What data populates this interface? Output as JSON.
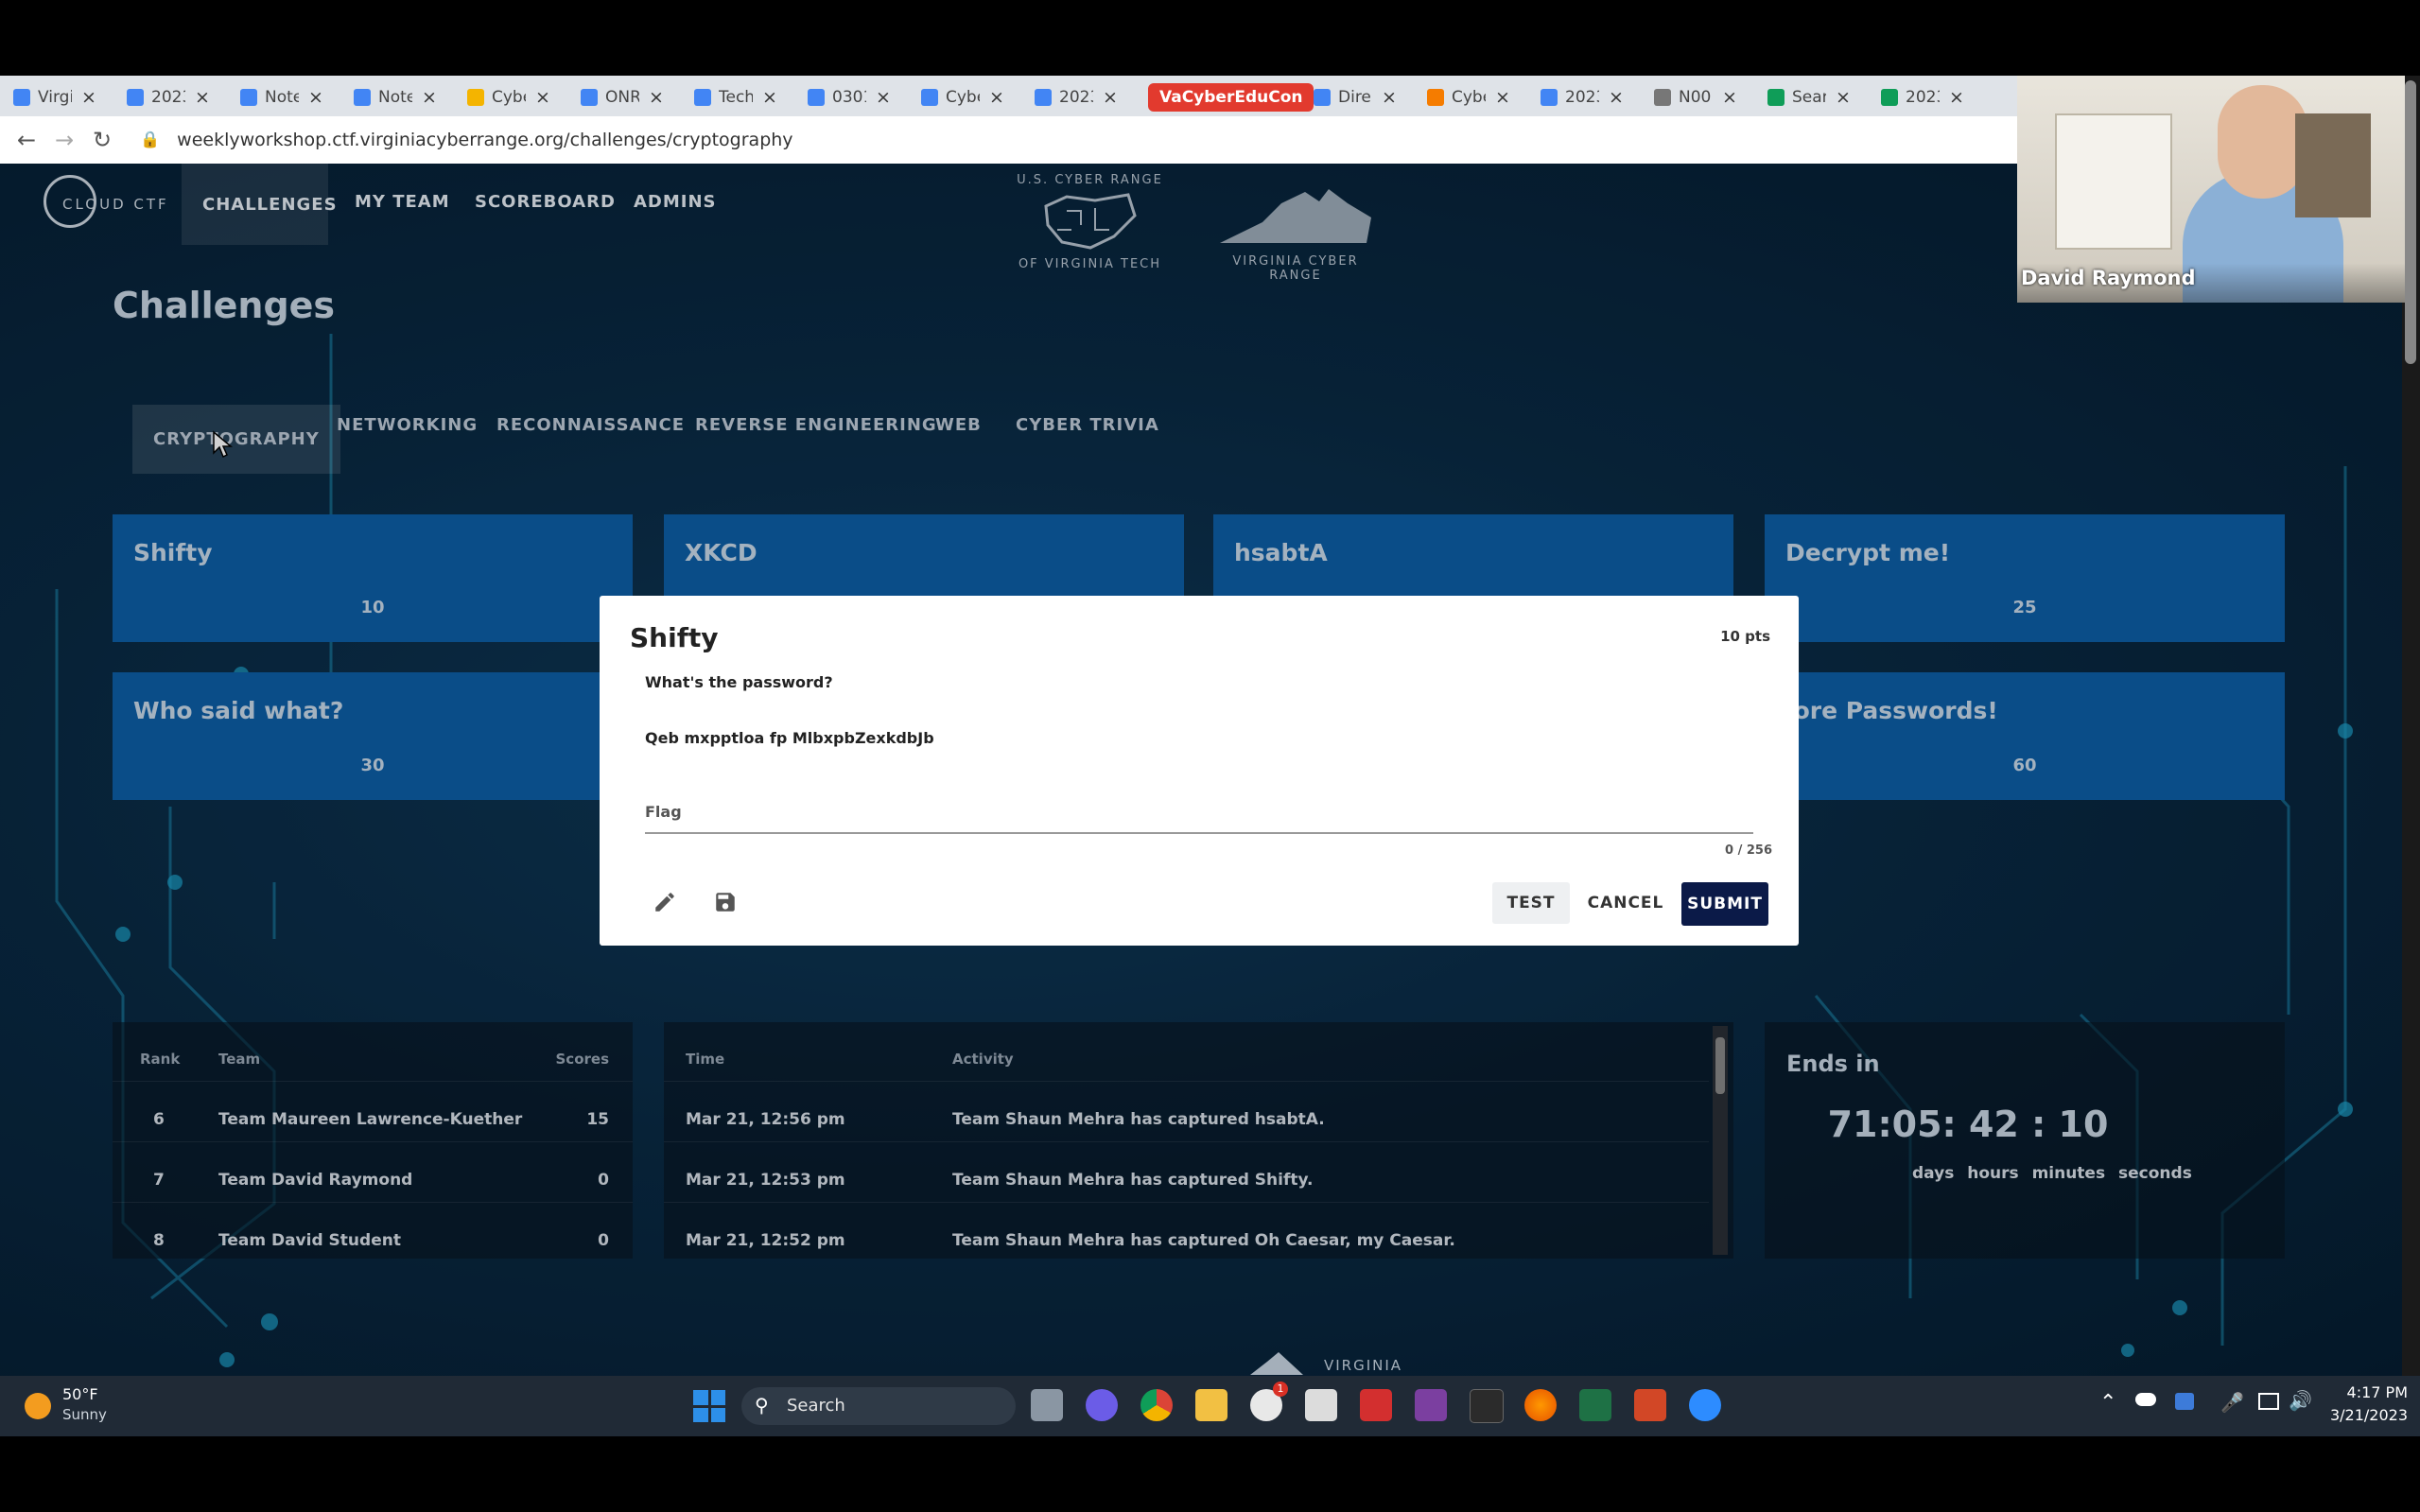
{
  "browser": {
    "tabs": [
      {
        "title": "Virgi",
        "color": "#4285f4"
      },
      {
        "title": "2023",
        "color": "#4285f4"
      },
      {
        "title": "Note",
        "color": "#4285f4"
      },
      {
        "title": "Note",
        "color": "#4285f4"
      },
      {
        "title": "Cybe",
        "color": "#f4b400"
      },
      {
        "title": "ONR",
        "color": "#4285f4"
      },
      {
        "title": "Tech",
        "color": "#4285f4"
      },
      {
        "title": "0301",
        "color": "#4285f4"
      },
      {
        "title": "Cybe",
        "color": "#4285f4"
      },
      {
        "title": "2023",
        "color": "#4285f4"
      },
      {
        "title": "VaCyberEduCon",
        "color": "#e23a2e"
      },
      {
        "title": "Dire",
        "color": "#4285f4"
      },
      {
        "title": "Cybe",
        "color": "#f57c00"
      },
      {
        "title": "2023",
        "color": "#4285f4"
      },
      {
        "title": "N00",
        "color": "#777777"
      },
      {
        "title": "Sear",
        "color": "#0f9d58"
      },
      {
        "title": "2023",
        "color": "#0f9d58"
      }
    ],
    "url": "weeklyworkshop.ctf.virginiacyberrange.org/challenges/cryptography"
  },
  "site": {
    "logo_text": "CLOUD CTF",
    "nav": [
      "CHALLENGES",
      "MY TEAM",
      "SCOREBOARD",
      "ADMINS"
    ],
    "partner1_top": "U.S. CYBER RANGE",
    "partner1_bottom": "OF VIRGINIA TECH",
    "partner2": "VIRGINIA CYBER RANGE"
  },
  "page_title": "Challenges",
  "categories": [
    "CRYPTOGRAPHY",
    "NETWORKING",
    "RECONNAISSANCE",
    "REVERSE ENGINEERING",
    "WEB",
    "CYBER TRIVIA"
  ],
  "cards": [
    {
      "title": "Shifty",
      "points": "10"
    },
    {
      "title": "XKCD",
      "points": ""
    },
    {
      "title": "hsabtA",
      "points": ""
    },
    {
      "title": "Decrypt me!",
      "points": "25"
    },
    {
      "title": "Who said what?",
      "points": "30"
    },
    {
      "title": "lore Passwords!",
      "points": "60"
    }
  ],
  "modal": {
    "title": "Shifty",
    "points": "10 pts",
    "question": "What's the password?",
    "cipher": "Qeb mxpptloa fp MlbxpbZexkdbJb",
    "flag_label": "Flag",
    "counter": "0 / 256",
    "test": "TEST",
    "cancel": "CANCEL",
    "submit": "SUBMIT"
  },
  "scoreboard": {
    "headers": [
      "Rank",
      "Team",
      "Scores"
    ],
    "rows": [
      {
        "rank": "6",
        "team": "Team Maureen Lawrence-Kuether",
        "score": "15"
      },
      {
        "rank": "7",
        "team": "Team David Raymond",
        "score": "0"
      },
      {
        "rank": "8",
        "team": "Team David Student",
        "score": "0"
      }
    ]
  },
  "activity": {
    "headers": [
      "Time",
      "Activity"
    ],
    "rows": [
      {
        "time": "Mar 21, 12:56 pm",
        "text": "Team Shaun Mehra has captured hsabtA."
      },
      {
        "time": "Mar 21, 12:53 pm",
        "text": "Team Shaun Mehra has captured Shifty."
      },
      {
        "time": "Mar 21, 12:52 pm",
        "text": "Team Shaun Mehra has captured Oh Caesar, my Caesar."
      }
    ]
  },
  "timer": {
    "title": "Ends in",
    "value": "71:05: 42 : 10",
    "units": [
      "days",
      "hours",
      "minutes",
      "seconds"
    ]
  },
  "footer_text": "VIRGINIA",
  "webcam_name": "David Raymond",
  "taskbar": {
    "weather_temp": "50°F",
    "weather_cond": "Sunny",
    "search": "Search",
    "time": "4:17 PM",
    "date": "3/21/2023",
    "notify_badge": "1"
  }
}
